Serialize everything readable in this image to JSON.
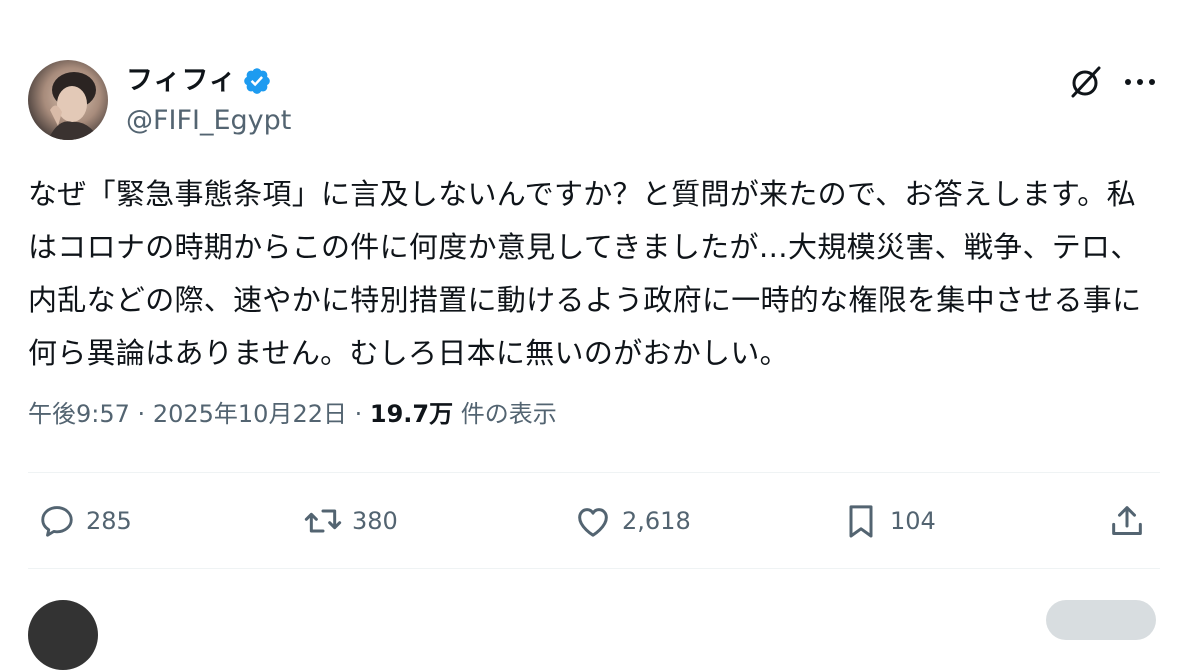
{
  "user": {
    "display_name": "フィフィ",
    "handle": "@FIFI_Egypt",
    "verified": true,
    "verified_color": "#1d9bf0"
  },
  "tweet": {
    "text": "なぜ「緊急事態条項」に言及しないんですか？と質問が来たので、お答えします。私はコロナの時期からこの件に何度か意見してきましたが…大規模災害、戦争、テロ、内乱などの際、速やかに特別措置に動けるよう政府に一時的な権限を集中させる事に何ら異論はありません。むしろ日本に無いのがおかしい。",
    "time": "午後9:57",
    "separator": "·",
    "date": "2025年10月22日",
    "views_count": "19.7万",
    "views_label": "件の表示"
  },
  "actions": {
    "reply": {
      "icon": "reply-icon",
      "count": "285"
    },
    "retweet": {
      "icon": "retweet-icon",
      "count": "380"
    },
    "like": {
      "icon": "heart-icon",
      "count": "2,618"
    },
    "bookmark": {
      "icon": "bookmark-icon",
      "count": "104"
    },
    "share": {
      "icon": "share-icon"
    }
  },
  "header_icons": [
    "grok-icon",
    "more-icon"
  ],
  "colors": {
    "text": "#0f1419",
    "muted": "#536471",
    "divider": "#eff3f4"
  }
}
